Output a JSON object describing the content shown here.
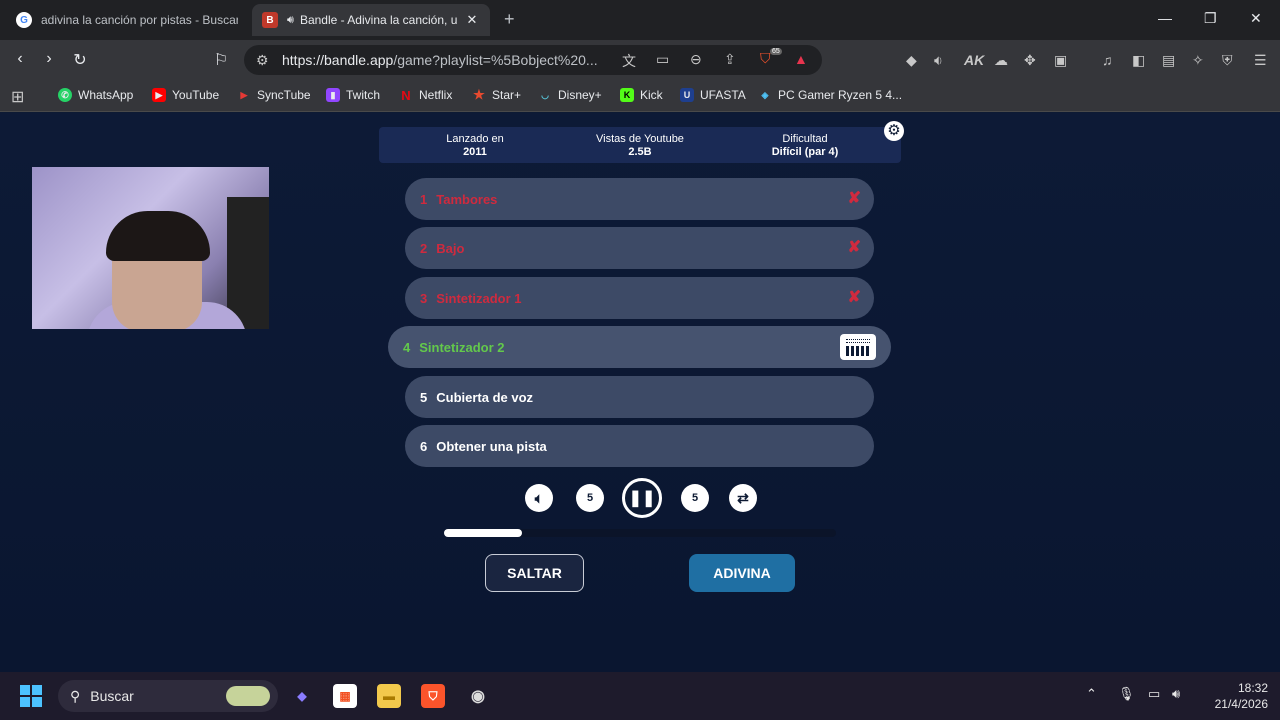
{
  "browser": {
    "tabs": [
      {
        "title": "adivina la canción por pistas - Buscar",
        "active": false
      },
      {
        "title": "Bandle - Adivina la canción, u",
        "active": true
      }
    ],
    "url_host": "https://bandle.app",
    "url_rest": "/game?playlist=%5Bobject%20...",
    "bookmarks": [
      "WhatsApp",
      "YouTube",
      "SyncTube",
      "Twitch",
      "Netflix",
      "Star+",
      "Disney+",
      "Kick",
      "UFASTA",
      "PC Gamer Ryzen 5 4..."
    ],
    "brave_badge": "65"
  },
  "game": {
    "info": [
      {
        "label": "Lanzado en",
        "value": "2011"
      },
      {
        "label": "Vistas de Youtube",
        "value": "2.5B"
      },
      {
        "label": "Dificultad",
        "value": "Difícil (par 4)"
      }
    ],
    "tracks": [
      {
        "num": "1",
        "label": "Tambores",
        "status": "wrong"
      },
      {
        "num": "2",
        "label": "Bajo",
        "status": "wrong"
      },
      {
        "num": "3",
        "label": "Sintetizador 1",
        "status": "wrong"
      },
      {
        "num": "4",
        "label": "Sintetizador 2",
        "status": "current"
      },
      {
        "num": "5",
        "label": "Cubierta de voz",
        "status": "pending"
      },
      {
        "num": "6",
        "label": "Obtener una pista",
        "status": "pending"
      }
    ],
    "rewind_label": "5",
    "forward_label": "5",
    "progress": 0.2,
    "skip_label": "SALTAR",
    "guess_label": "ADIVINA"
  },
  "taskbar": {
    "search_placeholder": "Buscar",
    "time": "18:32",
    "date": "21/4/2026"
  },
  "colors": {
    "background": "#0d1a33",
    "wrong": "#d02a3e",
    "current": "#63c94b",
    "guess_button": "#1f6fa3"
  }
}
